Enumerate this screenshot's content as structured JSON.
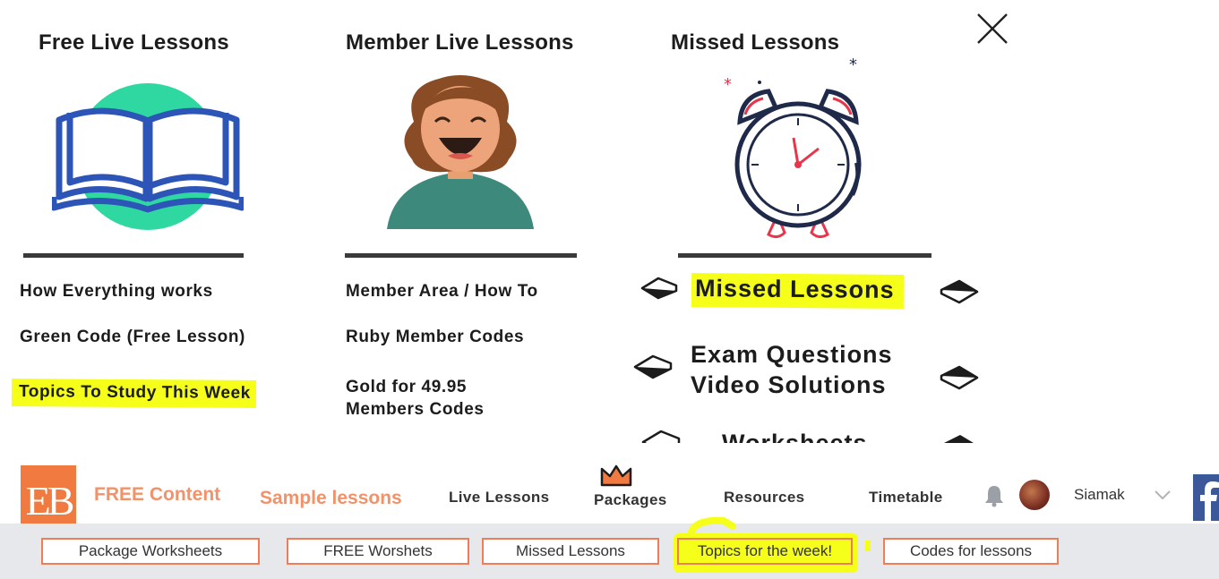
{
  "menu": {
    "columns": [
      {
        "title": "Free Live Lessons",
        "links": [
          "How Everything works",
          "Green Code (Free Lesson)",
          "Topics To Study This Week"
        ]
      },
      {
        "title": "Member Live Lessons",
        "links": [
          "Member Area / How To",
          "Ruby Member Codes",
          "Gold for 49.95",
          "Members Codes"
        ]
      },
      {
        "title": "Missed Lessons",
        "links": [
          "Missed Lessons",
          "Exam Questions",
          "Video Solutions",
          "Worksheets"
        ]
      }
    ],
    "highlight_color": "#f6ff1a"
  },
  "navbar": {
    "logo_text": "EB",
    "free_content": "FREE Content",
    "sample_lessons": "Sample lessons",
    "live_lessons": "Live Lessons",
    "packages": "Packages",
    "resources": "Resources",
    "timetable": "Timetable",
    "user_name": "Siamak",
    "accent_color": "#f07a3f"
  },
  "subnav": {
    "items": [
      "Package Worksheets",
      "FREE Worshets",
      "Missed Lessons",
      "Topics for the week!",
      "Codes for lessons"
    ]
  }
}
